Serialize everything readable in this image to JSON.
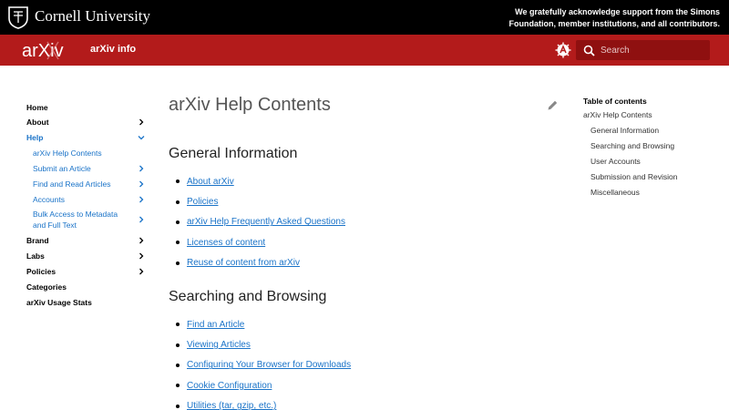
{
  "topbar": {
    "university": "Cornell University",
    "acknowledgment": "We gratefully acknowledge support from the Simons Foundation, member institutions, and all contributors."
  },
  "header": {
    "logo_text": "arXiv",
    "site_title": "arXiv info",
    "search_placeholder": "Search",
    "colors": {
      "brand_red": "#b31b1b",
      "topbar": "#000000",
      "link": "#1a73c8"
    }
  },
  "leftnav": {
    "items": [
      {
        "label": "Home",
        "level": 1,
        "chevron": "none"
      },
      {
        "label": "About",
        "level": 1,
        "chevron": "right"
      },
      {
        "label": "Help",
        "level": 1,
        "chevron": "down",
        "active": true
      },
      {
        "label": "arXiv Help Contents",
        "level": 2,
        "chevron": "none"
      },
      {
        "label": "Submit an Article",
        "level": 2,
        "chevron": "right"
      },
      {
        "label": "Find and Read Articles",
        "level": 2,
        "chevron": "right"
      },
      {
        "label": "Accounts",
        "level": 2,
        "chevron": "right"
      },
      {
        "label": "Bulk Access to Metadata and Full Text",
        "level": 2,
        "chevron": "right"
      },
      {
        "label": "Brand",
        "level": 1,
        "chevron": "right"
      },
      {
        "label": "Labs",
        "level": 1,
        "chevron": "right"
      },
      {
        "label": "Policies",
        "level": 1,
        "chevron": "right"
      },
      {
        "label": "Categories",
        "level": 1,
        "chevron": "none"
      },
      {
        "label": "arXiv Usage Stats",
        "level": 1,
        "chevron": "none"
      }
    ]
  },
  "main": {
    "title": "arXiv Help Contents",
    "sections": [
      {
        "title": "General Information",
        "links": [
          "About arXiv",
          "Policies",
          "arXiv Help Frequently Asked Questions",
          "Licenses of content",
          "Reuse of content from arXiv"
        ]
      },
      {
        "title": "Searching and Browsing",
        "links": [
          "Find an Article",
          "Viewing Articles",
          "Configuring Your Browser for Downloads",
          "Cookie Configuration",
          "Utilities (tar, gzip, etc.)"
        ]
      }
    ]
  },
  "toc": {
    "title": "Table of contents",
    "root": "arXiv Help Contents",
    "items": [
      "General Information",
      "Searching and Browsing",
      "User Accounts",
      "Submission and Revision",
      "Miscellaneous"
    ]
  }
}
